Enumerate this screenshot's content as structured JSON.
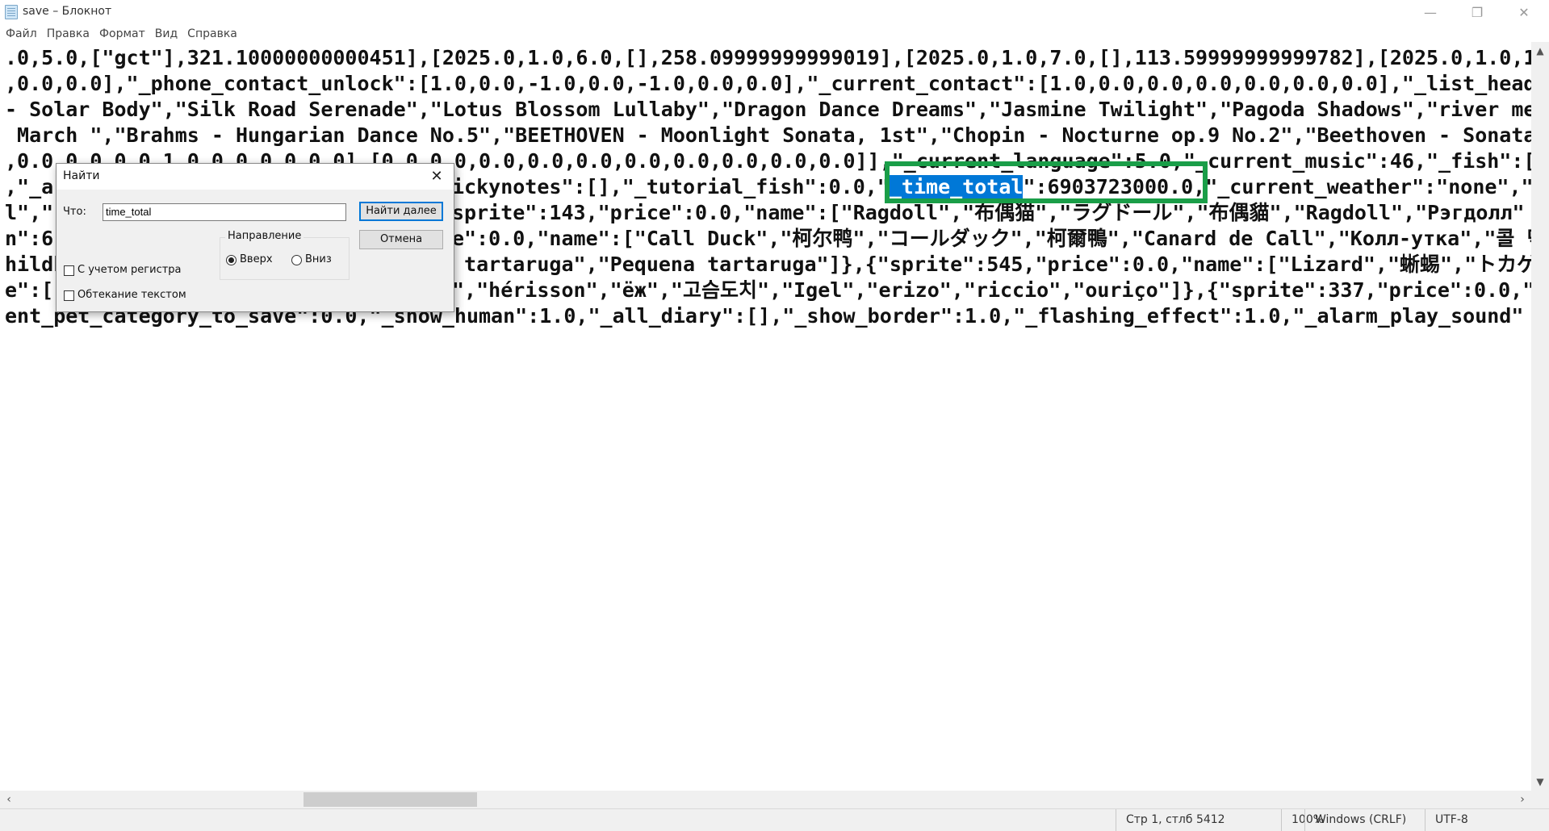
{
  "window": {
    "title": "save – Блокнот",
    "controls": {
      "minimize": "—",
      "maximize": "❐",
      "close": "✕"
    }
  },
  "menu": [
    "Файл",
    "Правка",
    "Формат",
    "Вид",
    "Справка"
  ],
  "editor": {
    "lines": [
      ".0,5.0,[\"gct\"],321.10000000000451],[2025.0,1.0,6.0,[],258.09999999999019],[2025.0,1.0,7.0,[],113.59999999999782],[2025.0,1.0,1",
      ",0.0,0.0],\"_phone_contact_unlock\":[1.0,0.0,-1.0,0.0,-1.0,0.0,0.0],\"_current_contact\":[1.0,0.0,0.0,0.0,0.0,0.0,0.0],\"_list_head",
      "- Solar Body\",\"Silk Road Serenade\",\"Lotus Blossom Lullaby\",\"Dragon Dance Dreams\",\"Jasmine Twilight\",\"Pagoda Shadows\",\"river me",
      " March \",\"Brahms - Hungarian Dance No.5\",\"BEETHOVEN - Moonlight Sonata, 1st\",\"Chopin - Nocturne op.9 No.2\",\"Beethoven - Sonata",
      ",0.0,0.0,0.0,1.0,0.0,0.0,0.0],[0.0,0.0,0.0,0.0,0.0,0.0,0.0,0.0,0.0,0.0]],\"_current_language\":5.0,\"_current_music\":46,\"_fish\":[[\"ob",
      ",\"_a",
      "l\",\"",
      "n\":6",
      "hildk",
      "e\":[\"",
      "ent_pet_category_to_save\":0.0,\"_show_human\":1.0,\"_all_diary\":[],\"_show_border\":1.0,\"_flashing_effect\":1.0,\"_alarm_play_sound\""
    ],
    "partial_lines": {
      "line6_before": "ickynotes\":[],\"_tutorial_fish\":0.0,\"",
      "line6_selected": "_time_total",
      "line6_after": "\":6903723000.0,\"_current_weather\":\"none\",\"",
      "line7": "sprite\":143,\"price\":0.0,\"name\":[\"Ragdoll\",\"布偶猫\",\"ラグドール\",\"布偶貓\",\"Ragdoll\",\"Рэгдолл\"",
      "line8": "e\":0.0,\"name\":[\"Call Duck\",\"柯尔鸭\",\"コールダック\",\"柯爾鴨\",\"Canard de Call\",\"Колл-утка\",\"콜 덕",
      "line9": " tartaruga\",\"Pequena tartaruga\"]},{\"sprite\":545,\"price\":0.0,\"name\":[\"Lizard\",\"蜥蜴\",\"トカゲ",
      "line10": "\",\"hérisson\",\"ёж\",\"고슴도치\",\"Igel\",\"erizo\",\"riccio\",\"ouriço\"]},{\"sprite\":337,\"price\":0.0,\""
    }
  },
  "find_dialog": {
    "title": "Найти",
    "what_label": "Что:",
    "search_value": "time_total",
    "find_next": "Найти далее",
    "cancel": "Отмена",
    "direction_label": "Направление",
    "up_label": "Вверх",
    "down_label": "Вниз",
    "direction_selected": "up",
    "match_case_label": "С учетом регистра",
    "match_case_checked": false,
    "wrap_label": "Обтекание текстом",
    "wrap_checked": false
  },
  "statusbar": {
    "position": "Стр 1, стлб 5412",
    "zoom": "100%",
    "line_endings": "Windows (CRLF)",
    "encoding": "UTF-8"
  },
  "colors": {
    "selection": "#0078d7",
    "highlight_box": "#1a9e48"
  }
}
